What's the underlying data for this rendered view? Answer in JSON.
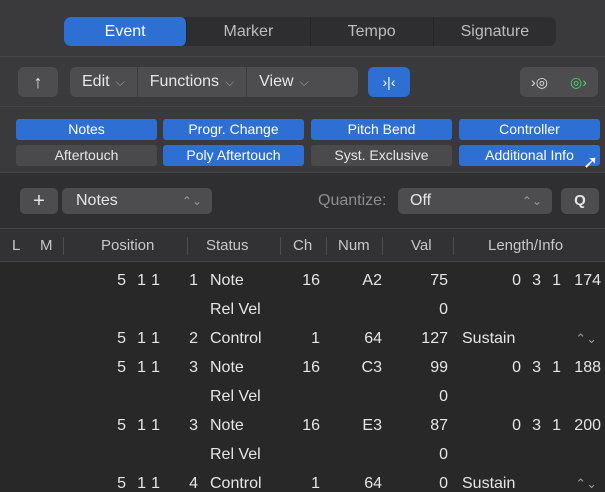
{
  "tabs": [
    "Event",
    "Marker",
    "Tempo",
    "Signature"
  ],
  "active_tab": "Event",
  "toolbar": {
    "up_icon": "arrow-up-icon",
    "menus": [
      "Edit",
      "Functions",
      "View"
    ],
    "catch_icon": "catch-playhead-icon",
    "midi_out_icon": "midi-out-icon",
    "midi_in_icon": "midi-in-icon"
  },
  "filters": {
    "row1": [
      "Notes",
      "Progr. Change",
      "Pitch Bend",
      "Controller"
    ],
    "row2": [
      "Aftertouch",
      "Poly Aftertouch",
      "Syst. Exclusive",
      "Additional Info"
    ],
    "row1_on": [
      true,
      true,
      true,
      true
    ],
    "row2_on": [
      false,
      true,
      false,
      true
    ]
  },
  "insert": {
    "plus": "+",
    "type": "Notes",
    "quantize_label": "Quantize:",
    "quantize_value": "Off",
    "q_button": "Q"
  },
  "columns": [
    "L",
    "M",
    "Position",
    "Status",
    "Ch",
    "Num",
    "Val",
    "Length/Info"
  ],
  "events": [
    {
      "pos": [
        "5",
        "1",
        "1",
        "1"
      ],
      "status": "Note",
      "ch": "16",
      "num": "A2",
      "val": "75",
      "len": [
        "0",
        "3",
        "1",
        "174"
      ],
      "info": ""
    },
    {
      "pos": [
        "",
        "",
        "",
        ""
      ],
      "status": "Rel Vel",
      "ch": "",
      "num": "",
      "val": "0",
      "len": [
        "",
        "",
        "",
        ""
      ],
      "info": ""
    },
    {
      "pos": [
        "5",
        "1",
        "1",
        "2"
      ],
      "status": "Control",
      "ch": "1",
      "num": "64",
      "val": "127",
      "len": [
        "",
        "",
        "",
        ""
      ],
      "info": "Sustain"
    },
    {
      "pos": [
        "5",
        "1",
        "1",
        "3"
      ],
      "status": "Note",
      "ch": "16",
      "num": "C3",
      "val": "99",
      "len": [
        "0",
        "3",
        "1",
        "188"
      ],
      "info": ""
    },
    {
      "pos": [
        "",
        "",
        "",
        ""
      ],
      "status": "Rel Vel",
      "ch": "",
      "num": "",
      "val": "0",
      "len": [
        "",
        "",
        "",
        ""
      ],
      "info": ""
    },
    {
      "pos": [
        "5",
        "1",
        "1",
        "3"
      ],
      "status": "Note",
      "ch": "16",
      "num": "E3",
      "val": "87",
      "len": [
        "0",
        "3",
        "1",
        "200"
      ],
      "info": ""
    },
    {
      "pos": [
        "",
        "",
        "",
        ""
      ],
      "status": "Rel Vel",
      "ch": "",
      "num": "",
      "val": "0",
      "len": [
        "",
        "",
        "",
        ""
      ],
      "info": ""
    },
    {
      "pos": [
        "5",
        "1",
        "1",
        "4"
      ],
      "status": "Control",
      "ch": "1",
      "num": "64",
      "val": "0",
      "len": [
        "",
        "",
        "",
        ""
      ],
      "info": "Sustain"
    }
  ],
  "colors": {
    "accent": "#2d6fd3",
    "midi_in_active": "#4cd964"
  }
}
